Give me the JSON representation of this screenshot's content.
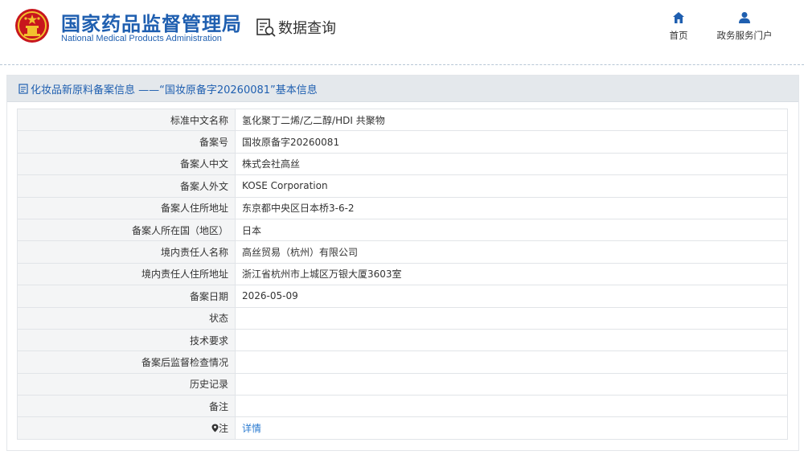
{
  "header": {
    "site_name_cn": "国家药品监督管理局",
    "site_name_en": "National Medical Products Administration",
    "data_query_label": "数据查询",
    "nav": [
      {
        "label": "首页",
        "icon": "home-icon"
      },
      {
        "label": "政务服务门户",
        "icon": "user-icon"
      }
    ],
    "brand_color": "#1f5fb0"
  },
  "panel": {
    "title": "化妆品新原料备案信息 ——“国妆原备字20260081”基本信息"
  },
  "rows": [
    {
      "label": "标准中文名称",
      "value": "氢化聚丁二烯/乙二醇/HDI 共聚物"
    },
    {
      "label": "备案号",
      "value": "国妆原备字20260081"
    },
    {
      "label": "备案人中文",
      "value": "株式会社高丝"
    },
    {
      "label": "备案人外文",
      "value": "KOSE Corporation"
    },
    {
      "label": "备案人住所地址",
      "value": "东京都中央区日本桥3-6-2"
    },
    {
      "label": "备案人所在国（地区）",
      "value": "日本"
    },
    {
      "label": "境内责任人名称",
      "value": "高丝贸易（杭州）有限公司"
    },
    {
      "label": "境内责任人住所地址",
      "value": "浙江省杭州市上城区万银大厦3603室"
    },
    {
      "label": "备案日期",
      "value": "2026-05-09"
    },
    {
      "label": "状态",
      "value": ""
    },
    {
      "label": "技术要求",
      "value": ""
    },
    {
      "label": "备案后监督检查情况",
      "value": ""
    },
    {
      "label": "历史记录",
      "value": ""
    },
    {
      "label": "备注",
      "value": ""
    }
  ],
  "note_row": {
    "label": "注",
    "icon": "location-pin-icon",
    "link": "详情"
  }
}
